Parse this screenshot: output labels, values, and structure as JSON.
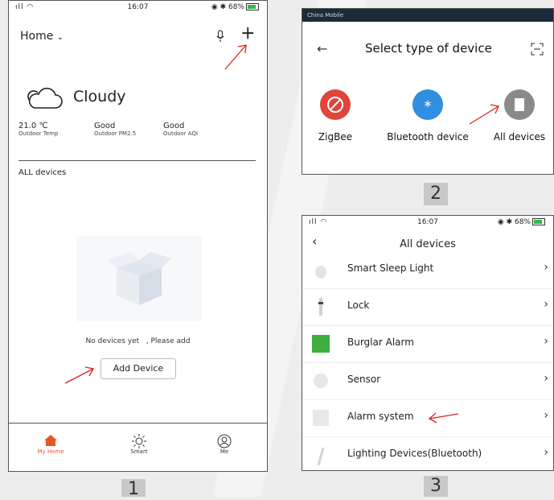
{
  "screen1": {
    "status": {
      "signal": "ıll",
      "time": "16:07",
      "battery": "68%"
    },
    "home_label": "Home",
    "weather": {
      "condition": "Cloudy"
    },
    "stats": [
      {
        "value": "21.0 ℃",
        "label": "Outdoor Temp"
      },
      {
        "value": "Good",
        "label": "Outdoor PM2.5"
      },
      {
        "value": "Good",
        "label": "Outdoor AQI"
      }
    ],
    "section_title": "ALL devices",
    "empty_text": "No devices yet   , Please add",
    "add_button": "Add Device",
    "tabs": [
      {
        "label": "My Home"
      },
      {
        "label": "Smart"
      },
      {
        "label": "Me"
      }
    ],
    "accent": "#e8542a"
  },
  "screen2": {
    "status_text": "China Mobile",
    "title": "Select type of device",
    "options": [
      {
        "label": "ZigBee",
        "color": "#e0443a"
      },
      {
        "label": "Bluetooth device",
        "color": "#2f8fe0"
      },
      {
        "label": "All devices",
        "color": "#8a8a8a"
      }
    ]
  },
  "screen3": {
    "status": {
      "signal": "ıll",
      "time": "16:07",
      "battery": "68%"
    },
    "title": "All devices",
    "items": [
      {
        "label": "Smart Sleep Light"
      },
      {
        "label": "Lock"
      },
      {
        "label": "Burglar Alarm"
      },
      {
        "label": "Sensor"
      },
      {
        "label": "Alarm system"
      },
      {
        "label": "Lighting Devices(Bluetooth)"
      }
    ]
  },
  "step_numbers": [
    "1",
    "2",
    "3"
  ]
}
